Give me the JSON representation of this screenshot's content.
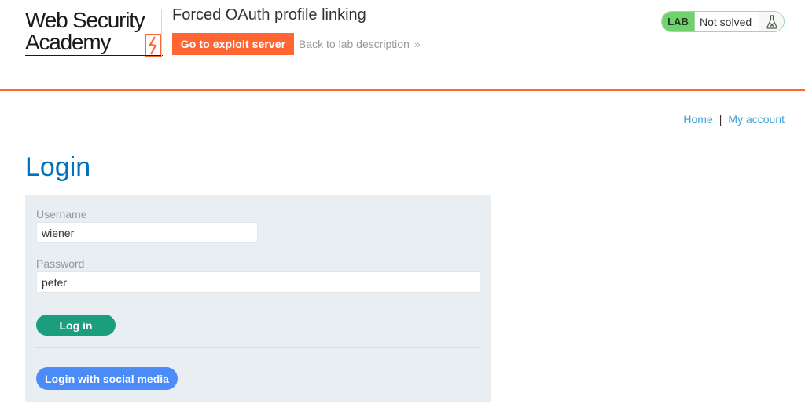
{
  "header": {
    "logo_line1": "Web Security",
    "logo_line2": "Academy",
    "lab_title": "Forced OAuth profile linking",
    "exploit_button": "Go to exploit server",
    "back_link": "Back to lab description",
    "back_chevron": "»",
    "lab_badge": "LAB",
    "lab_status": "Not solved",
    "lab_icon": "flask-icon"
  },
  "nav": {
    "home": "Home",
    "separator": "|",
    "my_account": "My account"
  },
  "login": {
    "title": "Login",
    "username_label": "Username",
    "username_value": "wiener",
    "password_label": "Password",
    "password_value": "peter",
    "login_button": "Log in",
    "social_button": "Login with social media"
  },
  "colors": {
    "accent_orange": "#ff6633",
    "lab_green": "#70d16d",
    "title_blue": "#0071bc",
    "link_blue": "#3c9fd6",
    "login_green": "#1a9e7e",
    "social_blue": "#4b8cf7",
    "panel_bg": "#e8eef1"
  }
}
